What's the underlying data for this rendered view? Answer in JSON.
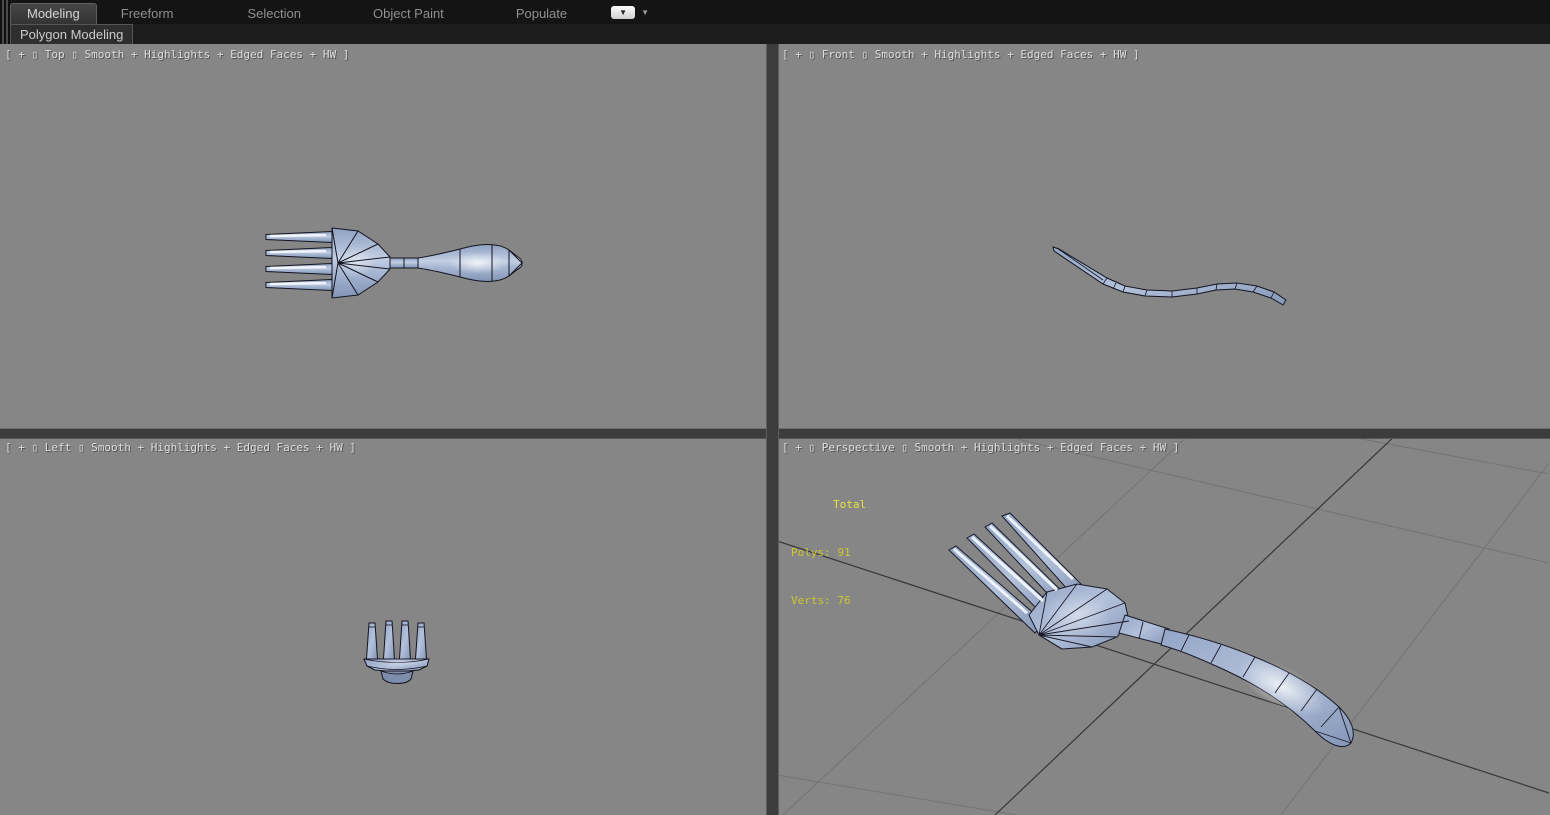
{
  "ribbon": {
    "tabs": [
      {
        "label": "Modeling",
        "active": true
      },
      {
        "label": "Freeform",
        "active": false
      },
      {
        "label": "Selection",
        "active": false
      },
      {
        "label": "Object Paint",
        "active": false
      },
      {
        "label": "Populate",
        "active": false
      }
    ],
    "minimize_icon": "▼",
    "options_caret": "▼",
    "panel_label": "Polygon Modeling"
  },
  "viewports": {
    "top": {
      "label": "[ + ▯ Top ▯ Smooth + Highlights + Edged Faces + HW ]"
    },
    "front": {
      "label": "[ + ▯ Front ▯ Smooth + Highlights + Edged Faces + HW ]"
    },
    "left": {
      "label": "[ + ▯ Left ▯ Smooth + Highlights + Edged Faces + HW ]"
    },
    "perspective": {
      "label": "[ + ▯ Perspective ▯ Smooth + Highlights + Edged Faces + HW ]",
      "stats": {
        "total_label": "Total",
        "polys": "Polys: 91",
        "verts": "Verts: 76"
      }
    }
  },
  "model": {
    "name": "fork",
    "polys": 91,
    "verts": 76
  },
  "colors": {
    "viewport_bg": "#868686",
    "ribbon_bg": "#141414",
    "stats_yellow": "#cdc92b",
    "stats_total_yellow": "#e8e23e",
    "fork_metal": "#9fb1cd",
    "wireframe": "#141420",
    "grid_dark": "#373737",
    "grid_light": "#747474"
  }
}
